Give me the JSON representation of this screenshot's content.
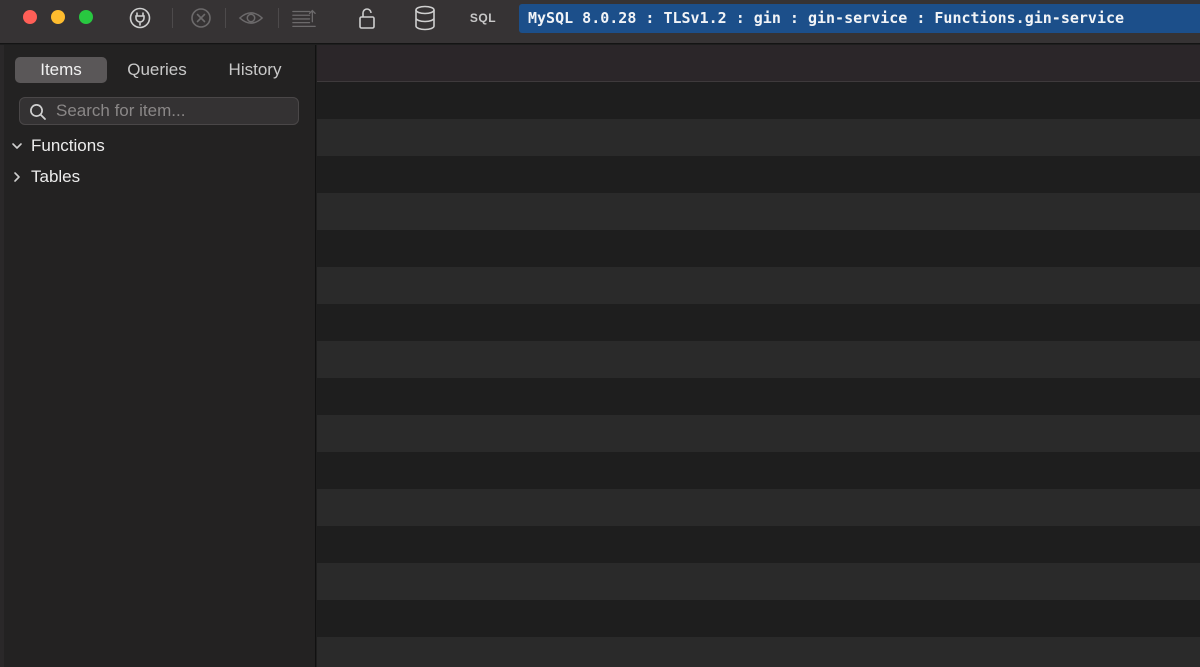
{
  "toolbar": {
    "sql_label": "SQL",
    "connection_info": "MySQL 8.0.28 : TLSv1.2 : gin : gin-service : Functions.gin-service",
    "icons": [
      "connection-plug-icon",
      "stop-icon",
      "preview-icon",
      "text-align-icon",
      "lock-icon",
      "database-icon"
    ]
  },
  "sidebar": {
    "tabs": [
      {
        "label": "Items",
        "selected": true
      },
      {
        "label": "Queries",
        "selected": false
      },
      {
        "label": "History",
        "selected": false
      }
    ],
    "search": {
      "placeholder": "Search for item...",
      "value": ""
    },
    "tree": [
      {
        "label": "Functions",
        "expanded": true
      },
      {
        "label": "Tables",
        "expanded": false
      }
    ]
  },
  "colors": {
    "accent": "#1c4f8a",
    "close": "#ff5f57",
    "minimize": "#febc2e",
    "maximize": "#28c840"
  }
}
